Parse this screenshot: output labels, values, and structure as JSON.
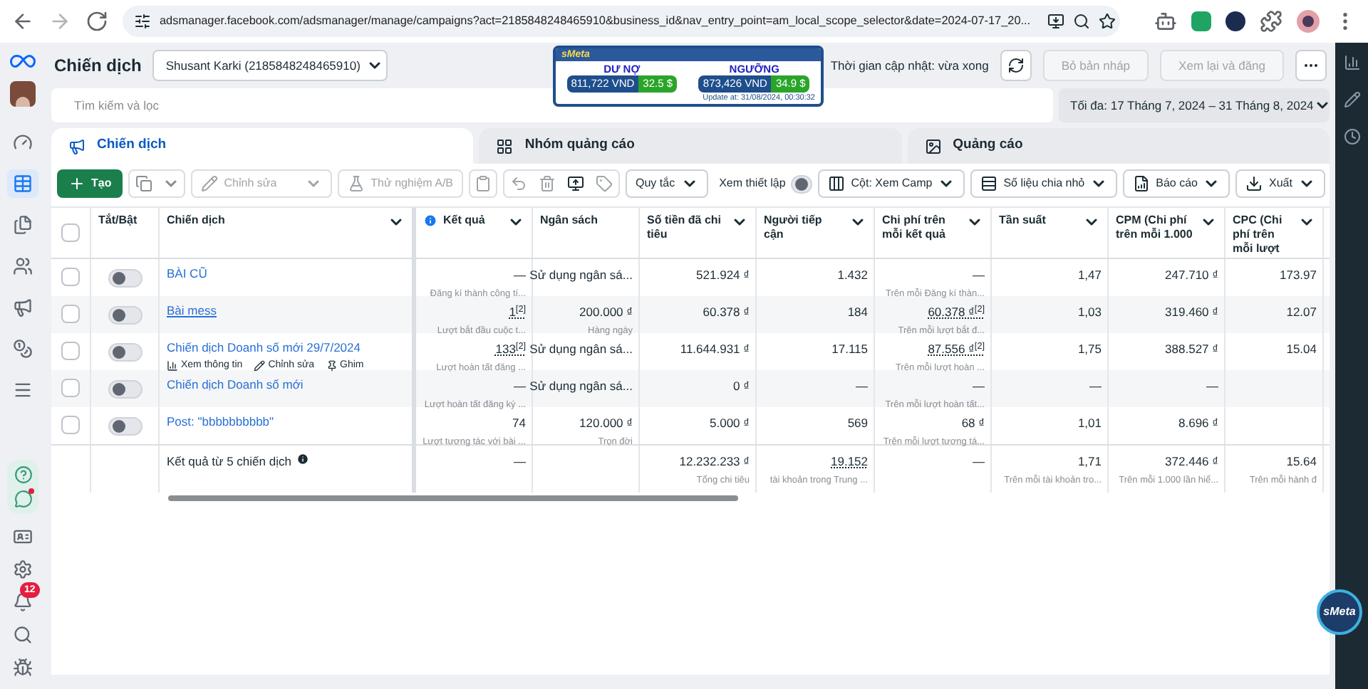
{
  "browser": {
    "url": "adsmanager.facebook.com/adsmanager/manage/campaigns?act=2185848248465910&business_id&nav_entry_point=am_local_scope_selector&date=2024-07-17_20..."
  },
  "header": {
    "title": "Chiến dịch",
    "account": "Shusant Karki (2185848248465910)",
    "update_text": "Thời gian cập nhật: vừa xong",
    "buttons": [
      {
        "label": "Bỏ bản nháp",
        "disabled": true
      },
      {
        "label": "Xem lại và đăng",
        "disabled": true
      }
    ]
  },
  "smeta": {
    "brand": "sMeta",
    "debt_label": "DƯ NỢ",
    "debt_vnd": "811,722 VND",
    "debt_usd": "32.5 $",
    "threshold_label": "NGƯỠNG",
    "threshold_vnd": "873,426 VND",
    "threshold_usd": "34.9 $",
    "updated": "Update at: 31/08/2024, 00:30:32"
  },
  "search": {
    "placeholder": "Tìm kiếm và lọc"
  },
  "date_range": "Tối đa: 17 Tháng 7, 2024 – 31 Tháng 8, 2024",
  "tabs": [
    {
      "label": "Chiến dịch",
      "selected": true
    },
    {
      "label": "Nhóm quảng cáo",
      "selected": false
    },
    {
      "label": "Quảng cáo",
      "selected": false
    }
  ],
  "toolbar": {
    "create": "Tạo",
    "edit": {
      "label": "Chỉnh sửa",
      "disabled": true
    },
    "ab_test": {
      "label": "Thử nghiệm A/B",
      "disabled": true
    },
    "rules": "Quy tắc",
    "view_setup": {
      "label": "Xem thiết lập",
      "on": false
    },
    "columns": "Cột: Xem Camp",
    "breakdown": "Số liệu chia nhỏ",
    "reports": "Báo cáo",
    "export": "Xuất"
  },
  "table": {
    "select_all_checked": false,
    "columns": [
      {
        "label": "Tắt/Bật",
        "info": false,
        "menu": false
      },
      {
        "label": "Chiến dịch",
        "info": false,
        "menu": true
      },
      {
        "label": "Kết quả",
        "info": true,
        "menu": true
      },
      {
        "label": "Ngân sách",
        "info": false,
        "menu": false
      },
      {
        "label": "Số tiền đã chi tiêu",
        "info": false,
        "menu": true
      },
      {
        "label": "Người tiếp cận",
        "info": false,
        "menu": true
      },
      {
        "label": "Chi phí trên mỗi kết quả",
        "info": false,
        "menu": true
      },
      {
        "label": "Tần suất",
        "info": false,
        "menu": true
      },
      {
        "label": "CPM (Chi phí trên mỗi 1.000",
        "info": false,
        "menu": true
      },
      {
        "label": "CPC (Chi phí trên mỗi lượt",
        "info": false,
        "menu": true
      }
    ],
    "rows": [
      {
        "checked": false,
        "cells": [
          {
            "kind": "toggle",
            "on": false
          },
          {
            "kind": "campaign",
            "text": "BÀI CŨ",
            "visited": false
          },
          {
            "kind": "metric",
            "text": "—",
            "sub": "Đăng kí thành công tí..."
          },
          {
            "kind": "metric",
            "text": "Sử dụng ngân sá..."
          },
          {
            "kind": "metric",
            "text": "521.924 ₫"
          },
          {
            "kind": "metric",
            "text": "1.432"
          },
          {
            "kind": "metric",
            "text": "—",
            "sub": "Trên mỗi Đăng kí thàn..."
          },
          {
            "kind": "metric",
            "text": "1,47"
          },
          {
            "kind": "metric",
            "text": "247.710 ₫"
          },
          {
            "kind": "metric",
            "text": "173.97"
          }
        ]
      },
      {
        "checked": false,
        "cells": [
          {
            "kind": "toggle",
            "on": false
          },
          {
            "kind": "campaign",
            "text": "Bài mess",
            "visited": true
          },
          {
            "kind": "metric",
            "text": "1$^{[2]}$",
            "sub": "Lượt bắt đầu cuộc t...",
            "underlined": true
          },
          {
            "kind": "metric",
            "text": "200.000 ₫",
            "sub": "Hàng ngày"
          },
          {
            "kind": "metric",
            "text": "60.378 ₫"
          },
          {
            "kind": "metric",
            "text": "184"
          },
          {
            "kind": "metric",
            "text": "60.378 ₫$^{[2]}$",
            "sub": "Trên mỗi lượt bắt đ...",
            "underlined": true
          },
          {
            "kind": "metric",
            "text": "1,03"
          },
          {
            "kind": "metric",
            "text": "319.460 ₫"
          },
          {
            "kind": "metric",
            "text": "12.07"
          }
        ]
      },
      {
        "checked": false,
        "cells": [
          {
            "kind": "toggle",
            "on": false
          },
          {
            "kind": "campaign",
            "text": "Chiến dịch Doanh số mới 29/7/2024",
            "visited": false,
            "actions": [
              "Xem thông tin",
              "Chỉnh sửa",
              "Ghim"
            ]
          },
          {
            "kind": "metric",
            "text": "133$^{[2]}$",
            "sub": "Lượt hoàn tất đăng ...",
            "underlined": true
          },
          {
            "kind": "metric",
            "text": "Sử dụng ngân sá..."
          },
          {
            "kind": "metric",
            "text": "11.644.931 ₫"
          },
          {
            "kind": "metric",
            "text": "17.115"
          },
          {
            "kind": "metric",
            "text": "87.556 ₫$^{[2]}$",
            "sub": "Trên mỗi lượt hoàn ...",
            "underlined": true
          },
          {
            "kind": "metric",
            "text": "1,75"
          },
          {
            "kind": "metric",
            "text": "388.527 ₫"
          },
          {
            "kind": "metric",
            "text": "15.04"
          }
        ]
      },
      {
        "checked": false,
        "cells": [
          {
            "kind": "toggle",
            "on": false
          },
          {
            "kind": "campaign",
            "text": "Chiến dịch Doanh số mới",
            "visited": false
          },
          {
            "kind": "metric",
            "text": "—",
            "sub": "Lượt hoàn tất đăng ký ..."
          },
          {
            "kind": "metric",
            "text": "Sử dụng ngân sá..."
          },
          {
            "kind": "metric",
            "text": "0 ₫"
          },
          {
            "kind": "metric",
            "text": "—"
          },
          {
            "kind": "metric",
            "text": "—",
            "sub": "Trên mỗi lượt hoàn tất..."
          },
          {
            "kind": "metric",
            "text": "—"
          },
          {
            "kind": "metric",
            "text": "—"
          },
          ""
        ]
      },
      {
        "checked": false,
        "cells": [
          {
            "kind": "toggle",
            "on": false
          },
          {
            "kind": "campaign",
            "text": "Post: \"bbbbbbbbbb\"",
            "visited": false
          },
          {
            "kind": "metric",
            "text": "74",
            "sub": "Lượt tương tác với bài ..."
          },
          {
            "kind": "metric",
            "text": "120.000 ₫",
            "sub": "Trọn đời"
          },
          {
            "kind": "metric",
            "text": "5.000 ₫"
          },
          {
            "kind": "metric",
            "text": "569"
          },
          {
            "kind": "metric",
            "text": "68 ₫",
            "sub": "Trên mỗi lượt tương tá..."
          },
          {
            "kind": "metric",
            "text": "1,01"
          },
          {
            "kind": "metric",
            "text": "8.696 ₫"
          },
          ""
        ]
      }
    ],
    "total": {
      "cells": [
        "",
        {
          "kind": "label",
          "text": "Kết quả từ 5 chiến dịch"
        },
        {
          "kind": "metric",
          "text": "—"
        },
        "",
        {
          "kind": "metric",
          "text": "12.232.233 ₫",
          "sub": "Tổng chi tiêu"
        },
        {
          "kind": "metric",
          "text": "19.152",
          "sub": "tài khoản trong Trung ...",
          "underlined": true
        },
        {
          "kind": "metric",
          "text": "—"
        },
        {
          "kind": "metric",
          "text": "1,71",
          "sub": "Trên mỗi tài khoản tro..."
        },
        {
          "kind": "metric",
          "text": "372.446 ₫",
          "sub": "Trên mỗi 1.000 lần hiể..."
        },
        {
          "kind": "metric",
          "text": "15.64",
          "sub": "Trên mỗi hành đ"
        }
      ]
    }
  },
  "notifications": "12",
  "floating_badge": "sMeta"
}
